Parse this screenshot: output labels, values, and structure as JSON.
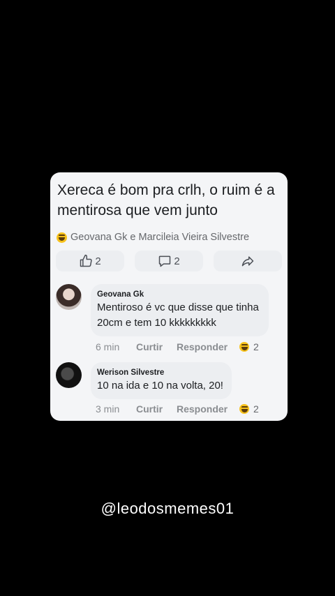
{
  "post": {
    "text": "Xereca é bom pra crlh, o ruim é a mentirosa que vem junto",
    "reactors": "Geovana Gk e Marcileia Vieira Silvestre",
    "reaction_icon": "laugh-emoji",
    "likes_count": "2",
    "comments_count": "2"
  },
  "comments": [
    {
      "name": "Geovana Gk",
      "text": "Mentiroso é vc que disse que tinha 20cm e tem 10 kkkkkkkkk",
      "time": "6 min",
      "like_label": "Curtir",
      "reply_label": "Responder",
      "reaction_count": "2"
    },
    {
      "name": "Werison Silvestre",
      "text": "10 na ida e 10 na volta, 20!",
      "time": "3 min",
      "like_label": "Curtir",
      "reply_label": "Responder",
      "reaction_count": "2"
    }
  ],
  "watermark": "@leodosmemes01",
  "colors": {
    "background": "#000000",
    "card": "#f4f5f7",
    "text": "#1c1e21",
    "muted": "#65676b",
    "laugh": "#f7c21c"
  }
}
